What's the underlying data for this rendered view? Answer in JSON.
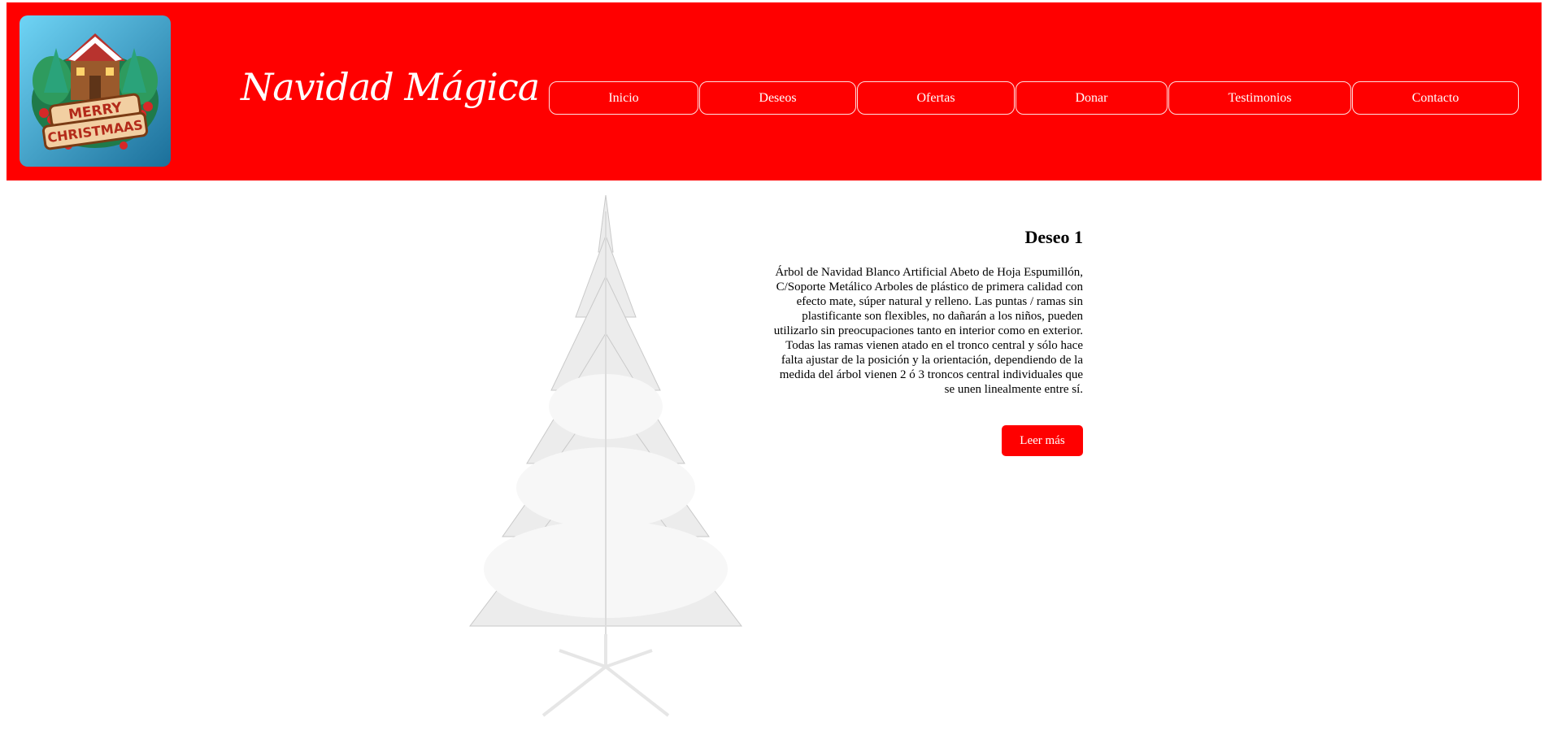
{
  "header": {
    "site_title": "Navidad Mágica",
    "logo_text": [
      "MERRY",
      "CHRISTMAAS"
    ],
    "background_color": "#ff0000"
  },
  "nav": {
    "items": [
      {
        "label": "Inicio"
      },
      {
        "label": "Deseos"
      },
      {
        "label": "Ofertas"
      },
      {
        "label": "Donar"
      },
      {
        "label": "Testimonios"
      },
      {
        "label": "Contacto"
      }
    ]
  },
  "wish": {
    "title": "Deseo 1",
    "description": "Árbol de Navidad Blanco Artificial Abeto de Hoja Espumillón, C/Soporte Metálico Arboles de plástico de primera calidad con efecto mate, súper natural y relleno. Las puntas / ramas sin plastificante son flexibles, no dañarán a los niños, pueden utilizarlo sin preocupaciones tanto en interior como en exterior. Todas las ramas vienen atado en el tronco central y sólo hace falta ajustar de la posición y la orientación, dependiendo de la medida del árbol vienen 2 ó 3 troncos central individuales que se unen linealmente entre sí.",
    "read_more_label": "Leer más",
    "image_icon": "white-christmas-tree"
  },
  "colors": {
    "accent": "#ff0000",
    "text": "#000000",
    "nav_text": "#ffffff"
  }
}
